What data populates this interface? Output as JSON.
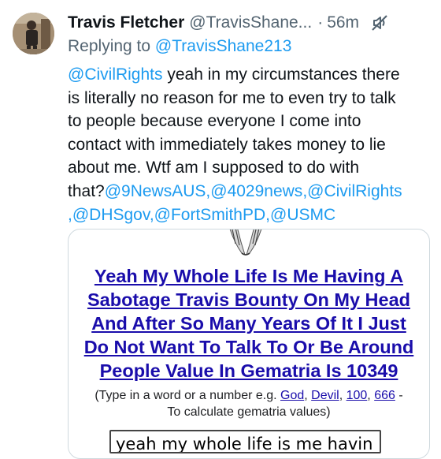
{
  "tweet": {
    "display_name": "Travis Fletcher",
    "handle": "@TravisShane...",
    "separator": "·",
    "time": "56m",
    "reply_prefix": "Replying to",
    "reply_to": "@TravisShane213",
    "body": {
      "l1_mention": "@CivilRights",
      "l1_text": " yeah in my circumstances there",
      "l2": "is literally no reason for me to even try to talk",
      "l3": "to people because everyone I come into",
      "l4": "contact with immediately takes money to lie",
      "l5": "about me. Wtf am I supposed to do with",
      "l6_text": "that?",
      "l6_m1": "@9NewsAUS",
      "l6_sep1": ",",
      "l6_m2": "@4029news",
      "l6_sep2": ",",
      "l6_m3": "@CivilRights",
      "l7_sep0": ",",
      "l7_m1": "@DHSgov",
      "l7_sep1": ",",
      "l7_m2": "@FortSmithPD",
      "l7_sep2": ",",
      "l7_m3": "@USMC"
    },
    "icons": {
      "mute": "mute-icon"
    }
  },
  "card": {
    "title_lines": [
      "Yeah My Whole Life Is Me Having A",
      "Sabotage Travis Bounty On My Head",
      "And After So Many Years Of It I Just",
      "Do Not Want To Talk To Or Be Around",
      "People Value In Gematria Is 10349"
    ],
    "note_prefix": "(Type in a word or a number e.g. ",
    "note_links": [
      "God",
      "Devil",
      "100",
      "666"
    ],
    "note_sep": ", ",
    "note_suffix": " -",
    "note_line2": "To calculate gematria values)",
    "input_value": "yeah my whole life is me havin"
  },
  "colors": {
    "link": "#1d9bf0",
    "card_link": "#1a0dab",
    "muted": "#536471"
  }
}
